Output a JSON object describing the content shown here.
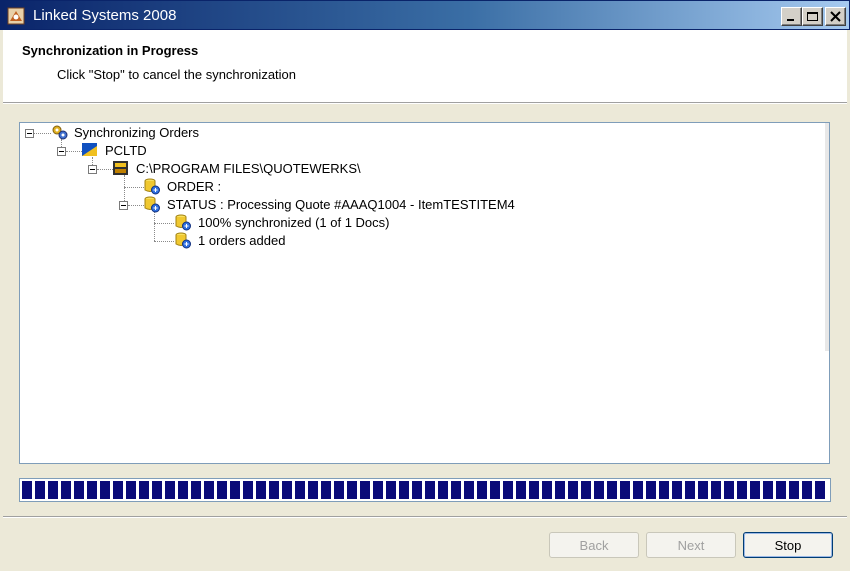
{
  "window": {
    "title": "Linked Systems 2008",
    "controls": [
      "minimize-icon",
      "maximize-icon",
      "close-icon"
    ]
  },
  "header": {
    "title": "Synchronization in Progress",
    "subtitle": "Click \"Stop\" to cancel the synchronization"
  },
  "tree": {
    "root": {
      "label": "Synchronizing Orders",
      "icon": "gears-icon"
    },
    "company": {
      "label": "PCLTD",
      "icon": "company-flag-icon"
    },
    "path": {
      "label": "C:\\PROGRAM FILES\\QUOTEWERKS\\",
      "icon": "quotewerks-icon"
    },
    "order": {
      "label": "ORDER :",
      "icon": "database-sync-icon"
    },
    "status": {
      "label": "STATUS : Processing Quote #AAAQ1004 - ItemTESTITEM4",
      "icon": "database-sync-icon"
    },
    "progress_text": {
      "label": "100% synchronized (1 of 1 Docs)",
      "icon": "database-sync-icon"
    },
    "orders_added": {
      "label": "1 orders added",
      "icon": "database-sync-icon"
    }
  },
  "progress": {
    "value_percent": 100,
    "color": "#0a0a78"
  },
  "buttons": {
    "back": "Back",
    "next": "Next",
    "stop": "Stop"
  }
}
